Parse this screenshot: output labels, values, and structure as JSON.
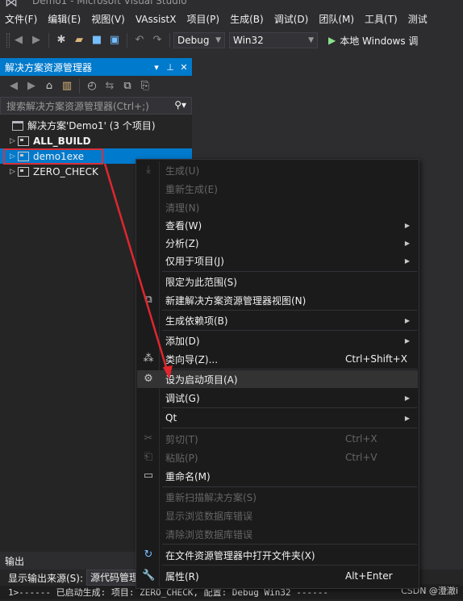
{
  "window": {
    "title": "Demo1 - Microsoft Visual Studio"
  },
  "menu": [
    "文件(F)",
    "编辑(E)",
    "视图(V)",
    "VAssistX",
    "项目(P)",
    "生成(B)",
    "调试(D)",
    "团队(M)",
    "工具(T)",
    "测试"
  ],
  "toolbar": {
    "configuration": "Debug",
    "platform": "Win32",
    "run_label": "本地 Windows 调"
  },
  "solution_explorer": {
    "title": "解决方案资源管理器",
    "search_placeholder": "搜索解决方案资源管理器(Ctrl+;)",
    "solution_label": "解决方案'Demo1' (3 个项目)",
    "projects": [
      "ALL_BUILD",
      "demo1exe",
      "ZERO_CHECK"
    ]
  },
  "context_menu": {
    "items": [
      {
        "label": "生成(U)",
        "disabled": true,
        "icon": "build-icon"
      },
      {
        "label": "重新生成(E)",
        "disabled": true
      },
      {
        "label": "清理(N)",
        "disabled": true
      },
      {
        "label": "查看(W)",
        "submenu": true
      },
      {
        "label": "分析(Z)",
        "submenu": true
      },
      {
        "label": "仅用于项目(J)",
        "submenu": true
      },
      {
        "label": "限定为此范围(S)"
      },
      {
        "label": "新建解决方案资源管理器视图(N)",
        "icon": "new-view-icon"
      },
      {
        "label": "生成依赖项(B)",
        "submenu": true
      },
      {
        "label": "添加(D)",
        "submenu": true
      },
      {
        "label": "类向导(Z)...",
        "shortcut": "Ctrl+Shift+X",
        "icon": "class-wizard-icon"
      },
      {
        "label": "设为启动项目(A)",
        "icon": "gear-icon"
      },
      {
        "label": "调试(G)",
        "submenu": true
      },
      {
        "label": "Qt",
        "submenu": true
      },
      {
        "label": "剪切(T)",
        "shortcut": "Ctrl+X",
        "disabled": true,
        "icon": "cut-icon"
      },
      {
        "label": "粘贴(P)",
        "shortcut": "Ctrl+V",
        "disabled": true,
        "icon": "paste-icon"
      },
      {
        "label": "重命名(M)",
        "icon": "rename-icon"
      },
      {
        "label": "重新扫描解决方案(S)",
        "disabled": true
      },
      {
        "label": "显示浏览数据库错误",
        "disabled": true
      },
      {
        "label": "清除浏览数据库错误",
        "disabled": true
      },
      {
        "label": "在文件资源管理器中打开文件夹(X)",
        "icon": "open-folder-icon"
      },
      {
        "label": "属性(R)",
        "shortcut": "Alt+Enter",
        "icon": "wrench-icon"
      }
    ]
  },
  "output": {
    "title": "输出",
    "source_label": "显示输出来源(S):",
    "source_value": "源代码管理",
    "line": "1>------ 已启动生成: 项目: ZERO_CHECK, 配置: Debug Win32 ------"
  },
  "watermark": "CSDN @澄澈i",
  "colors": {
    "accent": "#007acc",
    "annotation": "#e0262e"
  }
}
